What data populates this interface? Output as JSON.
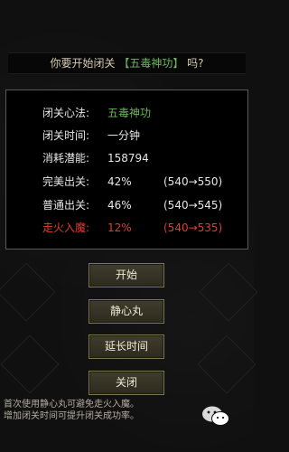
{
  "dialog": {
    "question": {
      "prefix": "你要开始闭关",
      "skill": "【五毒神功】",
      "suffix": "吗?"
    }
  },
  "info": {
    "rows": [
      {
        "label": "闭关心法:",
        "value": "五毒神功"
      },
      {
        "label": "闭关时间:",
        "value": "一分钟"
      },
      {
        "label": "消耗潜能:",
        "value": "158794"
      },
      {
        "label": "完美出关:",
        "value": "42%",
        "range": "(540→550)"
      },
      {
        "label": "普通出关:",
        "value": "46%",
        "range": "(540→545)"
      },
      {
        "label": "走火入魔:",
        "value": "12%",
        "range": "(540→535)"
      }
    ]
  },
  "buttons": {
    "start": "开始",
    "pill": "静心丸",
    "extend": "延长时间",
    "close": "关闭"
  },
  "footer": {
    "line1": "首次使用静心丸可避免走火入魔。",
    "line2": "增加闭关时间可提升闭关成功率。"
  },
  "colors": {
    "green_text": "#6fb35f",
    "red_text": "#e13c32",
    "button_border": "#7d7656"
  }
}
